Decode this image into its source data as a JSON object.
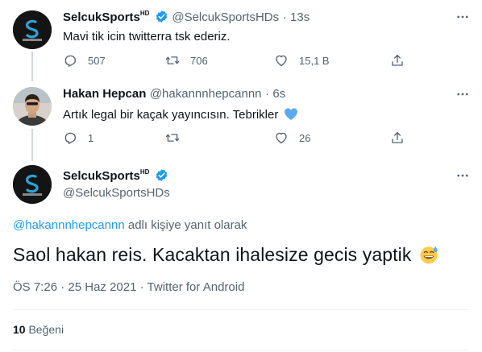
{
  "colors": {
    "accent": "#1d9bf0",
    "muted": "#536471",
    "text": "#0f1419",
    "divider": "#eff3f4",
    "heart": "#5ba8f5"
  },
  "tweet1": {
    "name": "SelcukSports",
    "name_sup": "HD",
    "handle": "@SelcukSportsHDs",
    "dot": "·",
    "time": "13s",
    "text": "Mavi tik icin twitterra tsk ederiz.",
    "replies": "507",
    "retweets": "706",
    "likes": "15,1 B"
  },
  "tweet2": {
    "name": "Hakan Hepcan",
    "handle": "@hakannnhepcannn",
    "dot": "·",
    "time": "6s",
    "text": "Artık legal bir kaçak yayıncısın. Tebrikler",
    "emoji": "blue-heart",
    "replies": "1",
    "retweets": "",
    "likes": "26"
  },
  "tweet3": {
    "name": "SelcukSports",
    "name_sup": "HD",
    "handle": "@SelcukSportsHDs",
    "replying_handle": "@hakannnhepcannn",
    "replying_suffix": "adlı kişiye yanıt olarak",
    "text": "Saol hakan reis. Kacaktan ihalesize gecis yaptik",
    "emoji": "grinning-sweat-face",
    "time": "ÖS 7:26",
    "sep1": "·",
    "date": "25 Haz 2021",
    "sep2": "·",
    "source": "Twitter for Android",
    "like_count": "10",
    "like_label": "Beğeni"
  },
  "icons": [
    "verified-badge-icon",
    "more-icon",
    "reply-icon",
    "retweet-icon",
    "like-icon",
    "share-icon"
  ]
}
